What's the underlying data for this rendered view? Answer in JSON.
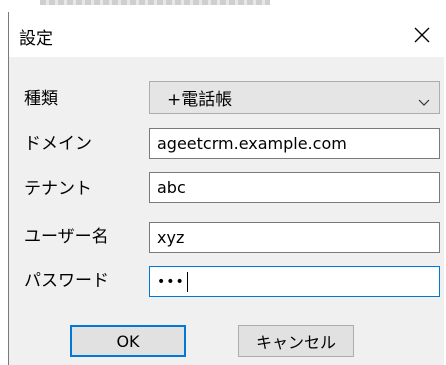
{
  "dialog": {
    "title": "設定",
    "close_icon": "close-icon"
  },
  "form": {
    "type": {
      "label": "種類",
      "value": "+電話帳"
    },
    "domain": {
      "label": "ドメイン",
      "value": "ageetcrm.example.com"
    },
    "tenant": {
      "label": "テナント",
      "value": "abc"
    },
    "username": {
      "label": "ユーザー名",
      "value": "xyz"
    },
    "password": {
      "label": "パスワード",
      "value": "•••"
    }
  },
  "buttons": {
    "ok": "OK",
    "cancel": "キャンセル"
  },
  "colors": {
    "focus_border": "#0078d7",
    "dialog_background": "#f0f0f0"
  }
}
